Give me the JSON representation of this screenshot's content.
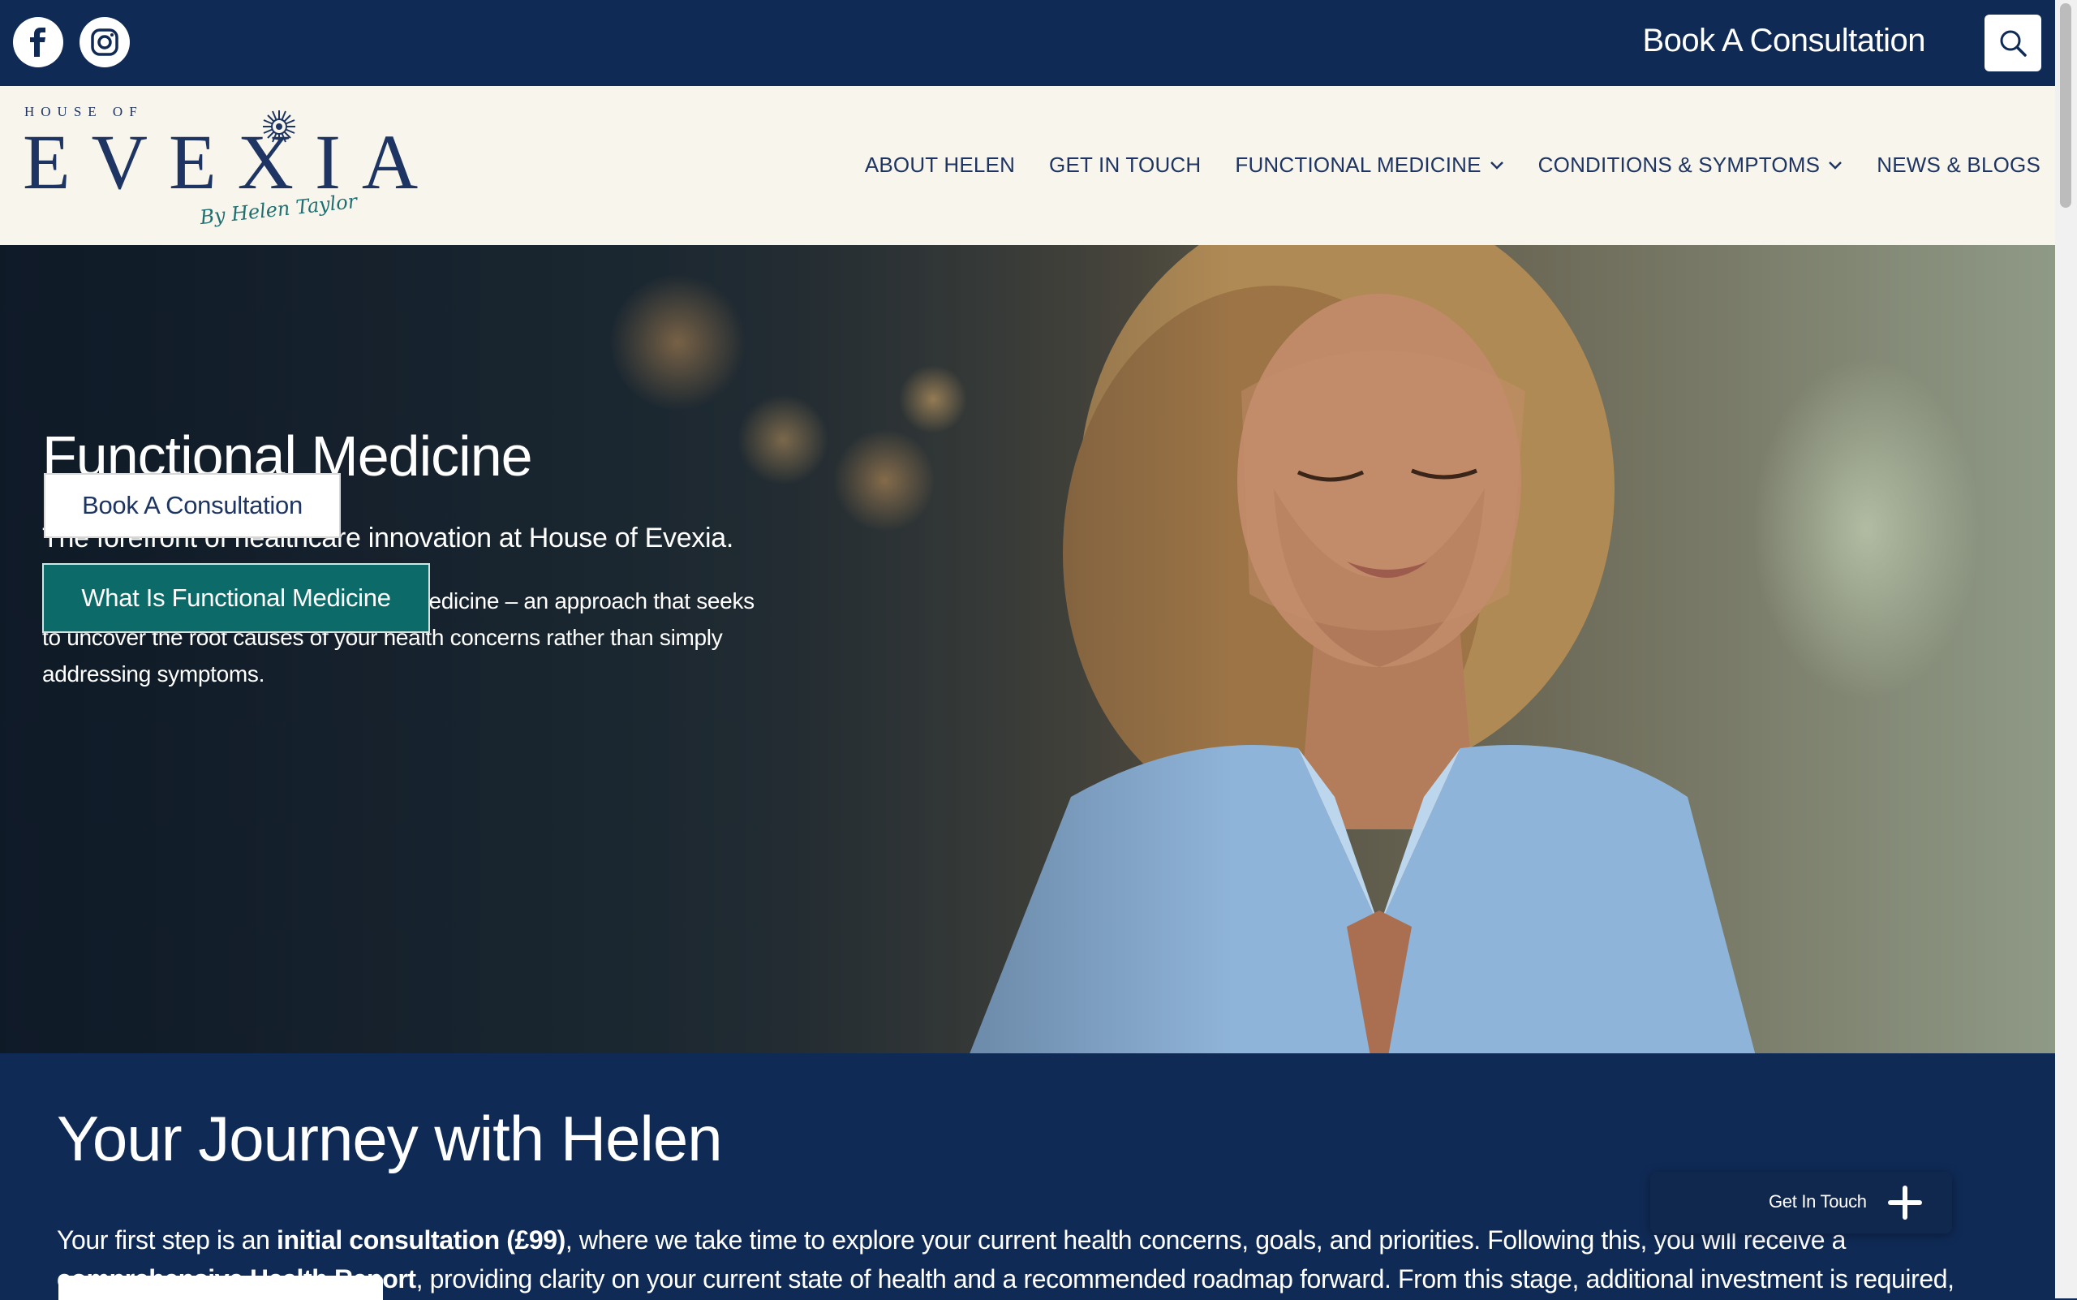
{
  "topbar": {
    "cta_label": "Book A Consultation",
    "social": [
      "facebook-icon",
      "instagram-icon"
    ],
    "search_icon": "search-icon"
  },
  "logo": {
    "top": "HOUSE OF",
    "main": "EVEXIA",
    "sub": "By Helen Taylor"
  },
  "nav": {
    "items": [
      {
        "label": "ABOUT HELEN"
      },
      {
        "label": "GET IN TOUCH"
      },
      {
        "label": "FUNCTIONAL MEDICINE",
        "dropdown": true
      },
      {
        "label": "CONDITIONS & SYMPTOMS",
        "dropdown": true
      },
      {
        "label": "NEWS & BLOGS"
      }
    ]
  },
  "hero": {
    "title": "Functional Medicine",
    "subtitle": "The forefront of healthcare innovation at House of Evexia.",
    "body": "We believe in the power of functional medicine – an approach that seeks to uncover the root causes of your health concerns rather than simply addressing symptoms.",
    "btn_book": "Book A Consultation",
    "btn_what": "What Is Functional Medicine"
  },
  "journey": {
    "title": "Your Journey with Helen",
    "text_1": "Your first step is an ",
    "text_bold_1": "initial consultation (£99)",
    "text_2": ", where we take time to explore your current health concerns, goals, and priorities. Following this, you will receive a ",
    "text_bold_2": "comprehensive Health Report",
    "text_3": ", providing clarity on your current state of health and a recommended roadmap forward. From this stage, additional investment is required,"
  },
  "floating": {
    "label": "Get In Touch"
  },
  "colors": {
    "navy": "#0f2a55",
    "cream": "#f8f5ec",
    "teal": "#0c6b69"
  }
}
